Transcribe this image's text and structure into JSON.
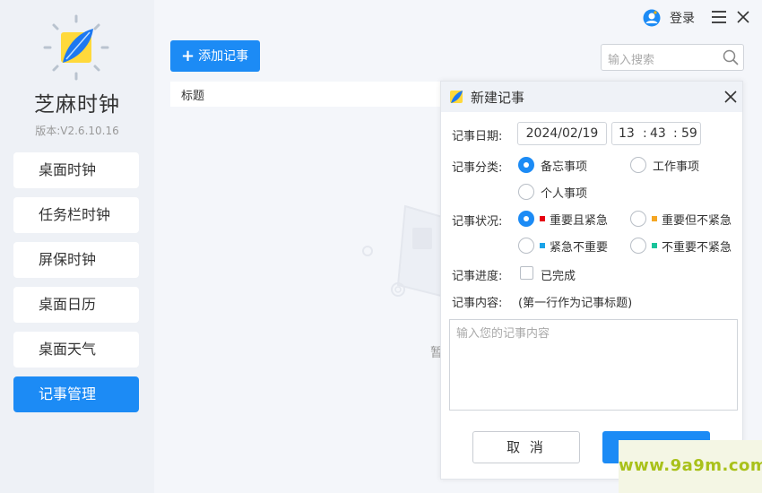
{
  "app": {
    "name": "芝麻时钟",
    "version": "版本:V2.6.10.16"
  },
  "sidebar": {
    "items": [
      {
        "label": "桌面时钟"
      },
      {
        "label": "任务栏时钟"
      },
      {
        "label": "屏保时钟"
      },
      {
        "label": "桌面日历"
      },
      {
        "label": "桌面天气"
      },
      {
        "label": "记事管理"
      }
    ],
    "active_index": 5
  },
  "topbar": {
    "login_label": "登录"
  },
  "toolbar": {
    "add_label": "添加记事",
    "search_placeholder": "输入搜索"
  },
  "list": {
    "header_title": "标题",
    "empty_text": "暂"
  },
  "dialog": {
    "title": "新建记事",
    "date_label": "记事日期:",
    "date_value": "2024/02/19",
    "time": {
      "hour": "13",
      "minute": "43",
      "second": "59",
      "sep": ":"
    },
    "category_label": "记事分类:",
    "category_options": [
      "备忘事项",
      "工作事项",
      "个人事项"
    ],
    "category_selected": "备忘事项",
    "status_label": "记事状况:",
    "status_options": [
      {
        "label": "重要且紧急",
        "color": "#e60012"
      },
      {
        "label": "重要但不紧急",
        "color": "#f5a623"
      },
      {
        "label": "紧急不重要",
        "color": "#1aa3e8"
      },
      {
        "label": "不重要不紧急",
        "color": "#19c39a"
      }
    ],
    "status_selected": "重要且紧急",
    "progress_label": "记事进度:",
    "progress_option": "已完成",
    "progress_checked": false,
    "content_label": "记事内容:",
    "content_hint": "(第一行作为记事标题)",
    "content_placeholder": "输入您的记事内容",
    "cancel_label": "取 消"
  },
  "watermark": {
    "text": "www.9a9m.com"
  },
  "colors": {
    "accent": "#1c8bf5",
    "sidebar_bg": "#eef1f6",
    "watermark": "#a9c11a"
  }
}
